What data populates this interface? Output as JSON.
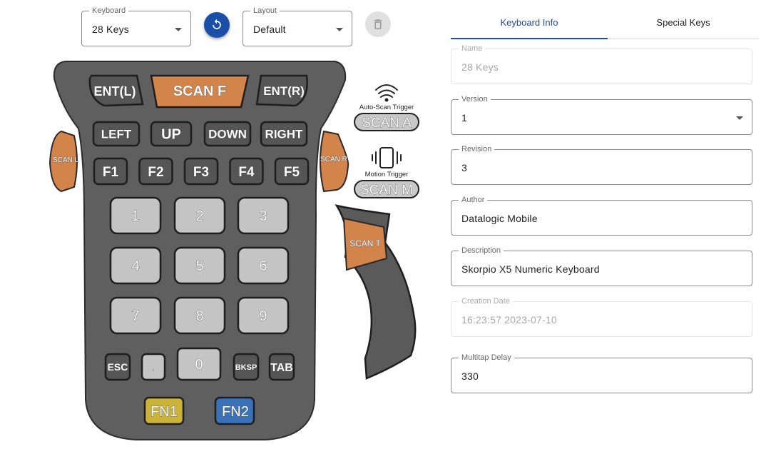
{
  "toolbar": {
    "keyboard_label": "Keyboard",
    "keyboard_value": "28 Keys",
    "layout_label": "Layout",
    "layout_value": "Default",
    "refresh_icon": "refresh-icon",
    "delete_icon": "trash-icon",
    "accent_color": "#1a4fa8"
  },
  "keyboard": {
    "top_keys": [
      "ENT(L)",
      "SCAN F",
      "ENT(R)"
    ],
    "nav_keys": [
      "LEFT",
      "UP",
      "DOWN",
      "RIGHT"
    ],
    "function_keys": [
      "F1",
      "F2",
      "F3",
      "F4",
      "F5"
    ],
    "number_keys": [
      "1",
      "2",
      "3",
      "4",
      "5",
      "6",
      "7",
      "8",
      "9"
    ],
    "bottom_keys": [
      "ESC",
      ".",
      "0",
      "BKSP",
      "TAB"
    ],
    "fn_keys": [
      "FN1",
      "FN2"
    ],
    "side_keys": [
      "SCAN L",
      "SCAN R",
      "SCAN T"
    ],
    "triggers": [
      {
        "label": "Auto-Scan Trigger",
        "key": "SCAN A",
        "icon": "wifi-signal-icon"
      },
      {
        "label": "Motion Trigger",
        "key": "SCAN M",
        "icon": "vibrate-phone-icon"
      }
    ],
    "colors": {
      "body": "#5f5f5f",
      "key": "#555555",
      "number_key": "#c4c4c4",
      "scan": "#d2844a",
      "fn1": "#cbb33a",
      "fn2": "#3a72b8"
    }
  },
  "tabs": [
    {
      "label": "Keyboard Info",
      "active": true
    },
    {
      "label": "Special Keys",
      "active": false
    }
  ],
  "info": {
    "name": {
      "label": "Name",
      "value": "28 Keys"
    },
    "version": {
      "label": "Version",
      "value": "1"
    },
    "revision": {
      "label": "Revision",
      "value": "3"
    },
    "author": {
      "label": "Author",
      "value": "Datalogic Mobile"
    },
    "description": {
      "label": "Description",
      "value": "Skorpio X5 Numeric Keyboard"
    },
    "creation_date": {
      "label": "Creation Date",
      "value": "16:23:57 2023-07-10"
    },
    "multitap_delay": {
      "label": "Multitap Delay",
      "value": "330"
    }
  }
}
